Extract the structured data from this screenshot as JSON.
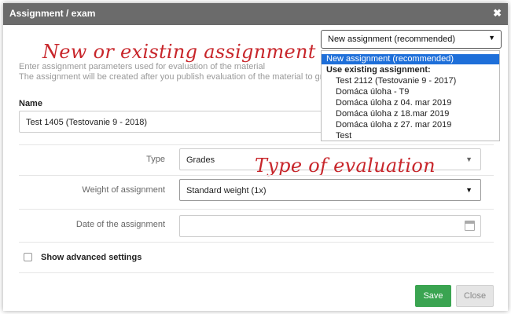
{
  "dialog": {
    "title": "Assignment / exam",
    "close_glyph": "✖"
  },
  "assignment_select": {
    "value": "New assignment (recommended)",
    "options": [
      {
        "label": "New assignment (recommended)",
        "kind": "selected"
      },
      {
        "label": "Use existing assignment:",
        "kind": "group"
      },
      {
        "label": "Test 2112 (Testovanie 9 - 2017)",
        "kind": "sub"
      },
      {
        "label": "Domáca úloha - T9",
        "kind": "sub"
      },
      {
        "label": "Domáca úloha z 04. mar 2019",
        "kind": "sub"
      },
      {
        "label": "Domáca úloha z 18.mar 2019",
        "kind": "sub"
      },
      {
        "label": "Domáca úloha z 27. mar 2019",
        "kind": "sub"
      },
      {
        "label": "Test",
        "kind": "sub"
      }
    ]
  },
  "annotations": {
    "assignment": "New or existing assignment",
    "evaluation": "Type of evaluation"
  },
  "hints": {
    "line1": "Enter assignment parameters used for evaluation of the material",
    "line2": "The assignment will be created after you publish evaluation of the material to gr"
  },
  "name_field": {
    "label": "Name",
    "value": "Test 1405 (Testovanie 9 - 2018)"
  },
  "type_field": {
    "label": "Type",
    "value": "Grades"
  },
  "weight_field": {
    "label": "Weight of assignment",
    "value": "Standard weight (1x)"
  },
  "date_field": {
    "label": "Date of the assignment",
    "value": "",
    "icon": "calendar-icon"
  },
  "advanced": {
    "label": "Show advanced settings",
    "checked": false
  },
  "buttons": {
    "save": "Save",
    "close": "Close"
  },
  "colors": {
    "titlebar": "#6b6b6b",
    "save": "#3aa451",
    "selected_option": "#1e6fd9",
    "annotation": "#c8262b"
  }
}
